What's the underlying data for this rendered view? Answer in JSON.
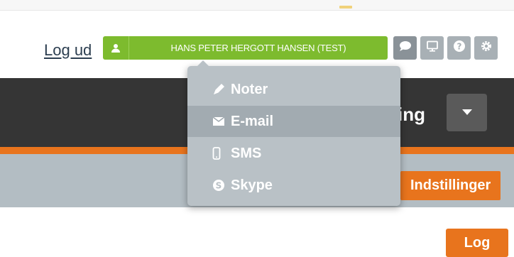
{
  "header": {
    "logout_label": "Log ud",
    "user_name": "HANS PETER HERGOTT HANSEN (TEST)"
  },
  "icons": {
    "user": "user-icon",
    "chat": "chat-icon",
    "monitor": "monitor-icon",
    "help": "help-icon",
    "gear": "gear-icon"
  },
  "contact_menu": {
    "items": [
      {
        "label": "Noter",
        "icon": "pencil-icon"
      },
      {
        "label": "E-mail",
        "icon": "envelope-icon"
      },
      {
        "label": "SMS",
        "icon": "phone-icon"
      },
      {
        "label": "Skype",
        "icon": "skype-icon"
      }
    ],
    "highlighted": "E-mail"
  },
  "darkbar": {
    "title_fragment": "ing"
  },
  "graybar": {
    "settings_label": "Indstillinger"
  },
  "log_button_label": "Log",
  "colors": {
    "accent_green": "#7dbb2e",
    "accent_orange": "#e8741d",
    "dark_bar": "#353535",
    "gray_bar": "#b3bdc3",
    "menu_bg": "#b9c1c6"
  }
}
